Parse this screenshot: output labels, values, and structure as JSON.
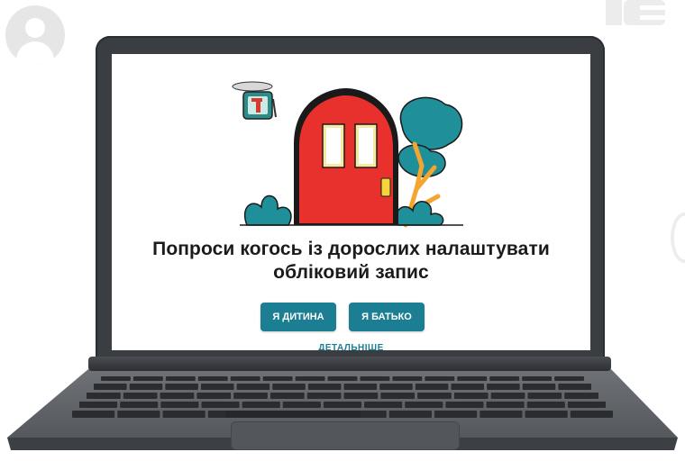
{
  "screen": {
    "headline_line1": "Попроси когось із дорослих налаштувати",
    "headline_line2": "обліковий запис",
    "buttons": {
      "child": "Я ДИТИНА",
      "parent": "Я БАТЬКО"
    },
    "more_link": "ДЕТАЛЬНІШЕ"
  },
  "colors": {
    "accent": "#1c7e92",
    "door": "#e8312d",
    "foliage": "#1f8f9a",
    "branch": "#f4a52e"
  },
  "icons": [
    "avatar-icon",
    "door-illustration",
    "drone-logo-icon"
  ]
}
